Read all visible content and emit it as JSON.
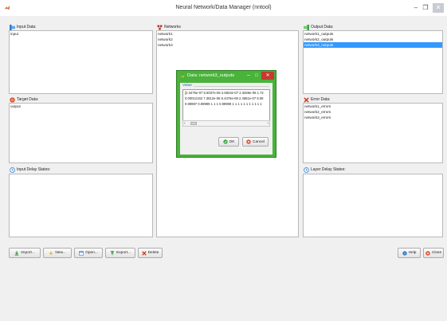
{
  "window": {
    "title": "Neural Network/Data Manager (nntool)",
    "min_glyph": "–",
    "max_glyph": "❐",
    "close_glyph": "✕"
  },
  "panels": {
    "input_data": {
      "label": "Input Data:",
      "items": [
        "input"
      ]
    },
    "networks": {
      "label": "Networks",
      "items": [
        "network1",
        "network2",
        "network3"
      ]
    },
    "output_data": {
      "label": "Output Data:",
      "items": [
        "network1_outputs",
        "network2_outputs",
        "network3_outputs"
      ],
      "selected": "network3_outputs"
    },
    "target_data": {
      "label": "Target Data:",
      "items": [
        "output"
      ]
    },
    "error_data": {
      "label": "Error Data:",
      "items": [
        "network1_errors",
        "network2_errors",
        "network3_errors"
      ]
    },
    "input_delay": {
      "label": "Input Delay States:",
      "items": []
    },
    "layer_delay": {
      "label": "Layer Delay States:",
      "items": []
    }
  },
  "toolbar": {
    "import": "Import...",
    "new": "New...",
    "open": "Open...",
    "export": "Export...",
    "delete": "Delete",
    "help": "Help",
    "close": "Close"
  },
  "dialog": {
    "title": "Data: network3_outputs",
    "group_label": "Value",
    "value_lines": [
      "[2.3475e-07 5.5037e-06 2.6824e-07 2.3266e-06 1.72",
      "0.00012162 7.3812e-06 6.4376e-08 2.4561e-07 6.08",
      "0.99997 0.99999 1 1 1 0.99999 1 1 1 1 1 1 1 1 1 1 1"
    ],
    "ok": "OK",
    "cancel": "Cancel",
    "min_glyph": "–",
    "max_glyph": "□",
    "close_glyph": "✕",
    "scroll_left": "‹",
    "scroll_right": "›"
  },
  "colors": {
    "dialog_frame": "#49b33a",
    "selection": "#3399ff",
    "close_red": "#c53a30"
  }
}
